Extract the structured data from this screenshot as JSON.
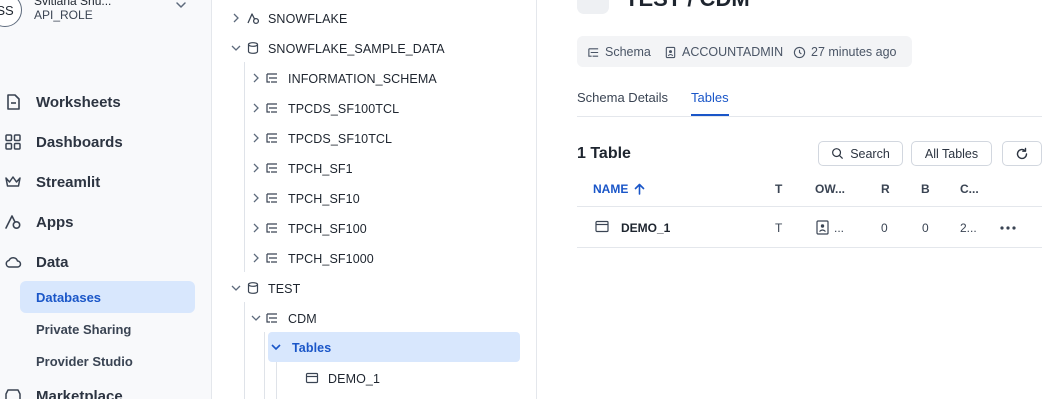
{
  "user": {
    "initials": "SS",
    "name": "Svitlana Shu...",
    "role": "API_ROLE"
  },
  "nav": {
    "items": [
      {
        "label": "Worksheets",
        "icon": "worksheet-icon"
      },
      {
        "label": "Dashboards",
        "icon": "dashboard-grid-icon"
      },
      {
        "label": "Streamlit",
        "icon": "crown-icon"
      },
      {
        "label": "Apps",
        "icon": "apps-icon"
      },
      {
        "label": "Data",
        "icon": "cloud-icon"
      },
      {
        "label": "Marketplace",
        "icon": "marketplace-icon"
      }
    ],
    "data_subitems": [
      {
        "label": "Databases",
        "active": true
      },
      {
        "label": "Private Sharing",
        "active": false
      },
      {
        "label": "Provider Studio",
        "active": false
      }
    ]
  },
  "tree": {
    "rows": [
      {
        "label": "SNOWFLAKE",
        "type": "share",
        "expanded": false
      },
      {
        "label": "SNOWFLAKE_SAMPLE_DATA",
        "type": "database",
        "expanded": true
      },
      {
        "label": "INFORMATION_SCHEMA",
        "type": "schema",
        "expanded": false
      },
      {
        "label": "TPCDS_SF100TCL",
        "type": "schema",
        "expanded": false
      },
      {
        "label": "TPCDS_SF10TCL",
        "type": "schema",
        "expanded": false
      },
      {
        "label": "TPCH_SF1",
        "type": "schema",
        "expanded": false
      },
      {
        "label": "TPCH_SF10",
        "type": "schema",
        "expanded": false
      },
      {
        "label": "TPCH_SF100",
        "type": "schema",
        "expanded": false
      },
      {
        "label": "TPCH_SF1000",
        "type": "schema",
        "expanded": false
      },
      {
        "label": "TEST",
        "type": "database",
        "expanded": true
      },
      {
        "label": "CDM",
        "type": "schema",
        "expanded": true
      },
      {
        "label": "Tables",
        "type": "folder",
        "expanded": true,
        "selected": true
      },
      {
        "label": "DEMO_1",
        "type": "table",
        "expanded": false
      }
    ]
  },
  "main": {
    "title": "TEST / CDM",
    "meta": {
      "kind": "Schema",
      "owner": "ACCOUNTADMIN",
      "created": "27 minutes ago"
    },
    "tabs": [
      {
        "label": "Schema Details",
        "active": false
      },
      {
        "label": "Tables",
        "active": true
      }
    ],
    "count_label": "1 Table",
    "buttons": {
      "search": "Search",
      "filter": "All Tables"
    },
    "table": {
      "headers": [
        "NAME",
        "T",
        "OW...",
        "R",
        "B",
        "C..."
      ],
      "sort_column": "NAME",
      "sort_direction": "ascending",
      "rows": [
        {
          "name": "DEMO_1",
          "type": "T",
          "owner": "...",
          "rows": "0",
          "bytes": "0",
          "created": "2..."
        }
      ]
    }
  },
  "colors": {
    "accent": "#1a56c8",
    "active_bg": "#d8e7fd",
    "nav_bg": "#f8f9fb"
  }
}
